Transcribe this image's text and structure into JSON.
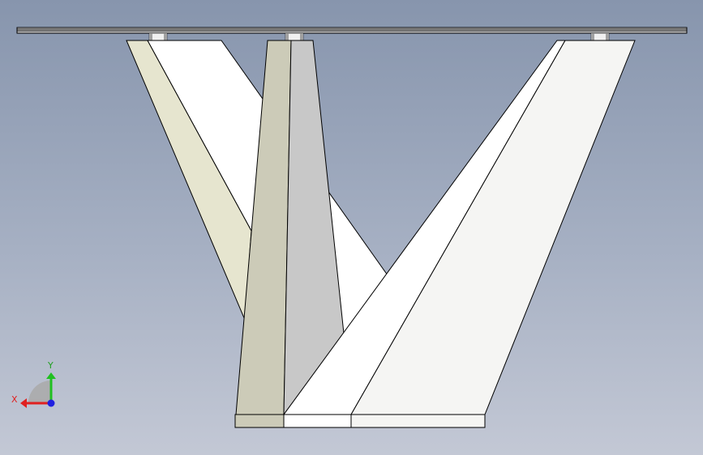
{
  "viewport": {
    "background_top": "#8795ad",
    "background_bottom": "#c3c8d5"
  },
  "model": {
    "tabletop_color": "#e6e6e6",
    "connector_color": "#f2f2f2",
    "leg_left_light": "#e6e5cf",
    "leg_left_white": "#ffffff",
    "leg_center_dark": "#cccbb8",
    "leg_center_gray": "#c8c8c8",
    "leg_right_white": "#ffffff",
    "leg_right_offwhite": "#f5f5f3",
    "edge_color": "#000000"
  },
  "triad": {
    "x_label": "X",
    "y_label": "Y",
    "x_color": "#e02020",
    "y_color": "#20c020",
    "z_color": "#2020e0"
  }
}
